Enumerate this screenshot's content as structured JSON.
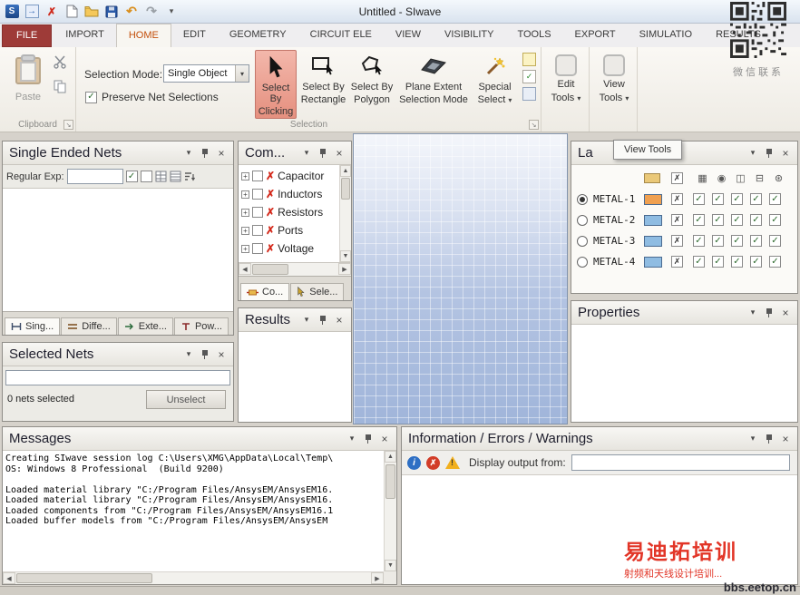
{
  "icons": {
    "dropdown": "▾",
    "close": "×",
    "check": "✓",
    "cross": "✗",
    "scroll_up": "▲",
    "scroll_down": "▼",
    "scroll_left": "◀",
    "scroll_right": "▶",
    "expand_plus": "+",
    "dialog_launcher": "↘",
    "undo": "↶",
    "redo": "↷",
    "info": "i",
    "warning": "!",
    "app_initial": "S",
    "import_arrow": "→",
    "layer_cols": [
      "▦",
      "◉",
      "◫",
      "⊟",
      "⊛"
    ]
  },
  "titlebar": {
    "title": "Untitled - SIwave"
  },
  "qr_caption": "微信联系",
  "ribbon": {
    "tabs": [
      {
        "label": "FILE"
      },
      {
        "label": "IMPORT"
      },
      {
        "label": "HOME"
      },
      {
        "label": "EDIT"
      },
      {
        "label": "GEOMETRY"
      },
      {
        "label": "CIRCUIT ELE"
      },
      {
        "label": "VIEW"
      },
      {
        "label": "VISIBILITY"
      },
      {
        "label": "TOOLS"
      },
      {
        "label": "EXPORT"
      },
      {
        "label": "SIMULATIO"
      },
      {
        "label": "RESULTS"
      }
    ],
    "clipboard": {
      "group_label": "Clipboard",
      "paste_label": "Paste"
    },
    "selection": {
      "group_label": "Selection",
      "mode_label": "Selection Mode:",
      "mode_value": "Single Object",
      "preserve_checkbox_label": "Preserve Net Selections",
      "select_by_clicking_line1": "Select By",
      "select_by_clicking_line2": "Clicking",
      "select_by_rectangle_line1": "Select By",
      "select_by_rectangle_line2": "Rectangle",
      "select_by_polygon_line1": "Select By",
      "select_by_polygon_line2": "Polygon",
      "plane_extent_line1": "Plane Extent",
      "plane_extent_line2": "Selection Mode",
      "special_select_line1": "Special",
      "special_select_line2": "Select"
    },
    "edit_tools_line1": "Edit",
    "edit_tools_line2": "Tools",
    "view_tools_line1": "View",
    "view_tools_line2": "Tools"
  },
  "tooltip": {
    "text": "View Tools"
  },
  "panels": {
    "single_ended_nets": {
      "title": "Single Ended Nets",
      "regex_label": "Regular Exp:",
      "tabs": [
        {
          "label": "Sing..."
        },
        {
          "label": "Diffe..."
        },
        {
          "label": "Exte..."
        },
        {
          "label": "Pow..."
        }
      ]
    },
    "selected_nets": {
      "title": "Selected Nets",
      "count_text": "0 nets selected",
      "unselect_label": "Unselect"
    },
    "components": {
      "title": "Com...",
      "items": [
        {
          "label": "Capacitor"
        },
        {
          "label": "Inductors"
        },
        {
          "label": "Resistors"
        },
        {
          "label": "Ports"
        },
        {
          "label": "Voltage"
        }
      ],
      "tabs": [
        {
          "label": "Co..."
        },
        {
          "label": "Sele..."
        }
      ]
    },
    "results": {
      "title": "Results"
    },
    "layers": {
      "title": "La",
      "rows": [
        {
          "name": "METAL-1",
          "selected": true,
          "swatch_color": "#f0a050"
        },
        {
          "name": "METAL-2",
          "selected": false,
          "swatch_color": "#8fbce2"
        },
        {
          "name": "METAL-3",
          "selected": false,
          "swatch_color": "#8fbce2"
        },
        {
          "name": "METAL-4",
          "selected": false,
          "swatch_color": "#8fbce2"
        }
      ]
    },
    "properties": {
      "title": "Properties"
    },
    "messages": {
      "title": "Messages",
      "log_text": "Creating SIwave session log C:\\Users\\XMG\\AppData\\Local\\Temp\\\nOS: Windows 8 Professional  (Build 9200)\n\nLoaded material library \"C:/Program Files/AnsysEM/AnsysEM16.\nLoaded material library \"C:/Program Files/AnsysEM/AnsysEM16.\nLoaded components from \"C:/Program Files/AnsysEM/AnsysEM16.1\nLoaded buffer models from \"C:/Program Files/AnsysEM/AnsysEM"
    },
    "info": {
      "title": "Information / Errors / Warnings",
      "display_output_label": "Display output from:"
    }
  },
  "watermark": {
    "line1": "易迪拓培训",
    "line2": "射频和天线设计培训...",
    "line3": "bbs.eetop.cn"
  },
  "colors": {
    "file_tab_bg": "#9e3b38",
    "active_tab_text": "#c3500c",
    "active_tool_highlight": "#e5907f",
    "canvas_bg": "#a0b5da",
    "metal1_swatch": "#f0a050",
    "metal_other_swatch": "#8fbce2",
    "watermark_red": "#e23527"
  }
}
